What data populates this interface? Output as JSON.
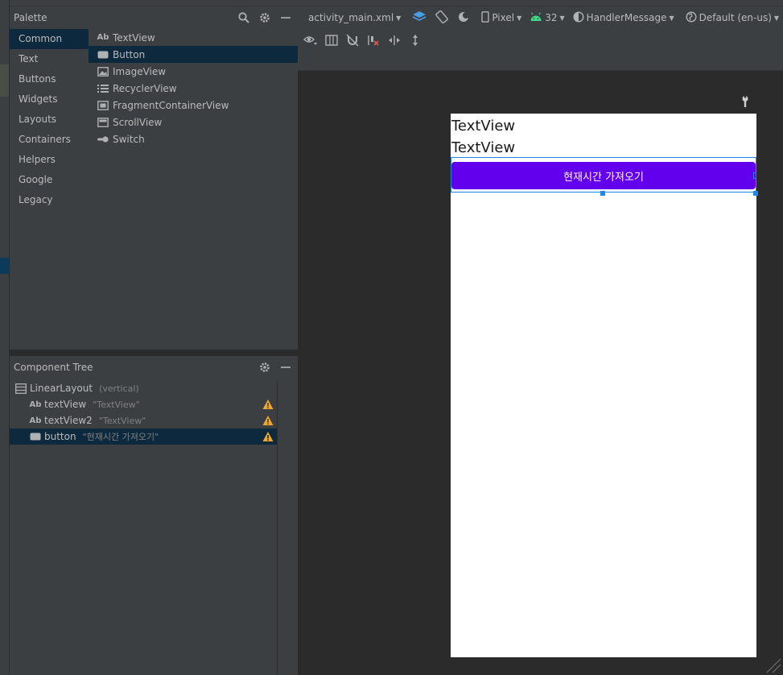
{
  "palette": {
    "title": "Palette",
    "categories": [
      "Common",
      "Text",
      "Buttons",
      "Widgets",
      "Layouts",
      "Containers",
      "Helpers",
      "Google",
      "Legacy"
    ],
    "items": [
      {
        "label": "TextView",
        "icon": "textview-icon"
      },
      {
        "label": "Button",
        "icon": "button-icon"
      },
      {
        "label": "ImageView",
        "icon": "image-icon"
      },
      {
        "label": "RecyclerView",
        "icon": "list-icon"
      },
      {
        "label": "FragmentContainerView",
        "icon": "fragment-icon"
      },
      {
        "label": "ScrollView",
        "icon": "scrollview-icon"
      },
      {
        "label": "Switch",
        "icon": "switch-icon"
      }
    ],
    "ab_glyph": "Ab"
  },
  "tree": {
    "title": "Component Tree",
    "root": {
      "label": "LinearLayout",
      "hint": "(vertical)"
    },
    "children": [
      {
        "label": "textView",
        "hint": "\"TextView\""
      },
      {
        "label": "textView2",
        "hint": "\"TextView\""
      },
      {
        "label": "button",
        "hint": "\"현재시간 가져오기\""
      }
    ]
  },
  "toolbar": {
    "file": "activity_main.xml",
    "device": "Pixel",
    "api": "32",
    "theme": "HandlerMessage",
    "locale": "Default (en-us)"
  },
  "preview": {
    "text1": "TextView",
    "text2": "TextView",
    "button": "현재시간 가져오기"
  },
  "colors": {
    "button": "#6200ee",
    "selection": "#1e88e5",
    "android_green": "#3ddc84",
    "warning": "#f0a732"
  }
}
